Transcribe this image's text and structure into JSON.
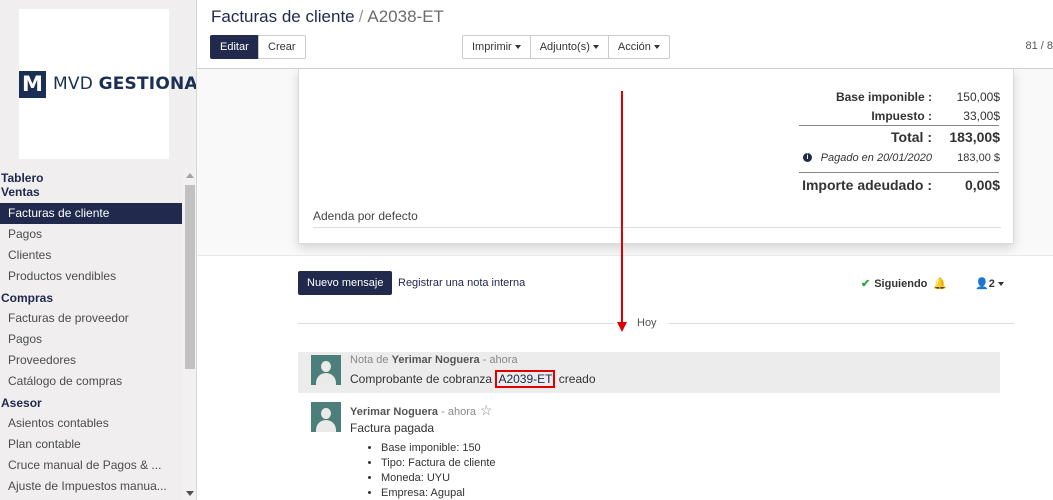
{
  "logo": {
    "mark": "M",
    "text_light": "MVD ",
    "text_bold": "GESTIONA"
  },
  "sidebar": {
    "sections": [
      {
        "title": "Tablero",
        "items": []
      },
      {
        "title": "Ventas",
        "items": [
          "Facturas de cliente",
          "Pagos",
          "Clientes",
          "Productos vendibles"
        ]
      },
      {
        "title": "Compras",
        "items": [
          "Facturas de proveedor",
          "Pagos",
          "Proveedores",
          "Catálogo de compras"
        ]
      },
      {
        "title": "Asesor",
        "items": [
          "Asientos contables",
          "Plan contable",
          "Cruce manual de Pagos & ...",
          "Ajuste de Impuestos manua..."
        ]
      }
    ],
    "active_item": "Facturas de cliente"
  },
  "header": {
    "breadcrumb_parent": "Facturas de cliente",
    "breadcrumb_sep": "/",
    "breadcrumb_current": "A2038-ET",
    "edit_label": "Editar",
    "create_label": "Crear",
    "print_label": "Imprimir",
    "attachments_label": "Adjunto(s)",
    "action_label": "Acción",
    "pager": "81 / 8"
  },
  "totals": {
    "base_label": "Base imponible :",
    "base_value": "150,00$",
    "tax_label": "Impuesto :",
    "tax_value": "33,00$",
    "total_label": "Total :",
    "total_value": "183,00$",
    "paid_label": "Pagado en 20/01/2020",
    "paid_value": "183,00 $",
    "due_label": "Importe adeudado :",
    "due_value": "0,00$"
  },
  "addendum": "Adenda por defecto",
  "chatter": {
    "new_message": "Nuevo mensaje",
    "internal_note": "Registrar una nota interna",
    "following": "Siguiendo",
    "followers": "2",
    "today": "Hoy",
    "messages": [
      {
        "prefix": "Nota de",
        "author": "Yerimar Noguera",
        "time": "- ahora",
        "text_before": "Comprobante de cobranza ",
        "link": "A2039-ET",
        "text_after": " creado"
      },
      {
        "author": "Yerimar Noguera",
        "time": "- ahora",
        "text": "Factura pagada",
        "bullets": [
          "Base imponible: 150",
          "Tipo: Factura de cliente",
          "Moneda: UYU",
          "Empresa: Agupal"
        ]
      }
    ]
  }
}
